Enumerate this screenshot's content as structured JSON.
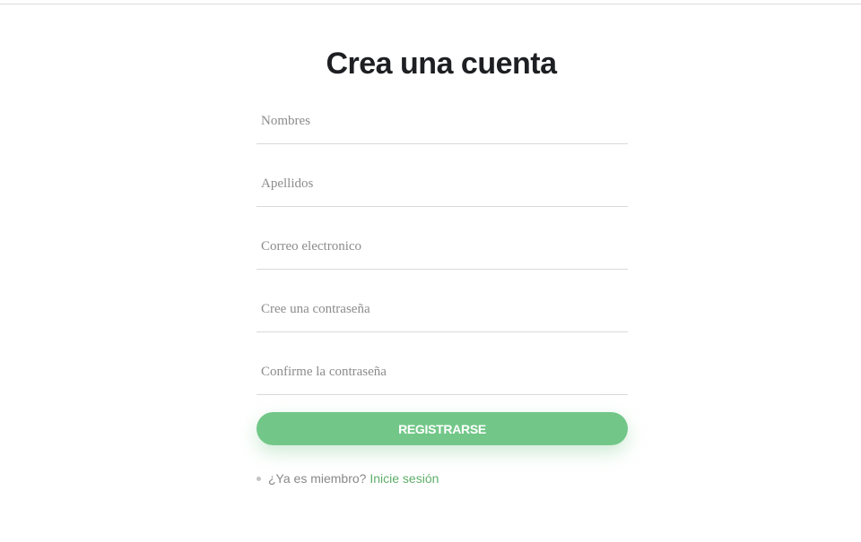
{
  "page": {
    "title": "Crea una cuenta"
  },
  "form": {
    "fields": [
      {
        "placeholder": "Nombres",
        "value": ""
      },
      {
        "placeholder": "Apellidos",
        "value": ""
      },
      {
        "placeholder": "Correo electronico",
        "value": ""
      },
      {
        "placeholder": "Cree una contraseña",
        "value": ""
      },
      {
        "placeholder": "Confirme la contraseña",
        "value": ""
      }
    ],
    "submit_label": "REGISTRARSE"
  },
  "footer": {
    "question": "¿Ya es miembro?",
    "login_link": "Inicie sesión"
  },
  "colors": {
    "accent": "#72c788",
    "link": "#5fae69",
    "title": "#1e1f23",
    "placeholder": "#8c8c8c",
    "divider": "#d9d9d9"
  },
  "icons": {
    "bullet": "list-bullet-icon"
  }
}
